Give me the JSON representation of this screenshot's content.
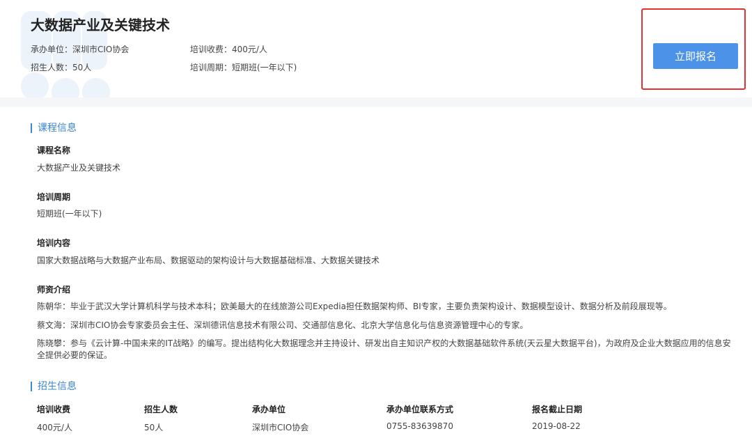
{
  "header": {
    "title": "大数据产业及关键技术",
    "organizer": "承办单位：深圳市CIO协会",
    "enrollment": "招生人数：50人",
    "fee": "培训收费：400元/人",
    "period": "培训周期：短期班(一年以下)",
    "apply_label": "立即报名"
  },
  "course_info": {
    "heading": "课程信息",
    "name_label": "课程名称",
    "name_value": "大数据产业及关键技术",
    "period_label": "培训周期",
    "period_value": "短期班(一年以下)",
    "content_label": "培训内容",
    "content_value": "国家大数据战略与大数据产业布局、数据驱动的架构设计与大数据基础标准、大数据关键技术",
    "teacher_label": "师资介绍",
    "teachers": [
      "陈朝华：毕业于武汉大学计算机科学与技术本科；欧美最大的在线旅游公司Expedia担任数据架构师、BI专家，主要负责架构设计、数据模型设计、数据分析及前段展现等。",
      "蔡文海：深圳市CIO协会专家委员会主任、深圳德讯信息技术有限公司、交通部信息化、北京大学信息化与信息资源管理中心的专家。",
      "陈晓攀：参与《云计算-中国未来的IT战略》的编写。提出结构化大数据理念并主持设计、研发出自主知识产权的大数据基础软件系统(天云星大数据平台)，为政府及企业大数据应用的信息安全提供必要的保证。"
    ]
  },
  "enroll_info": {
    "heading": "招生信息",
    "columns": [
      "培训收费",
      "招生人数",
      "承办单位",
      "承办单位联系方式",
      "报名截止日期"
    ],
    "values": [
      "400元/人",
      "50人",
      "深圳市CIO协会",
      "0755-83639870",
      "2019-08-22"
    ]
  },
  "colors": {
    "accent": "#3a86d8",
    "button": "#4b92e8",
    "highlight": "#e53030"
  }
}
